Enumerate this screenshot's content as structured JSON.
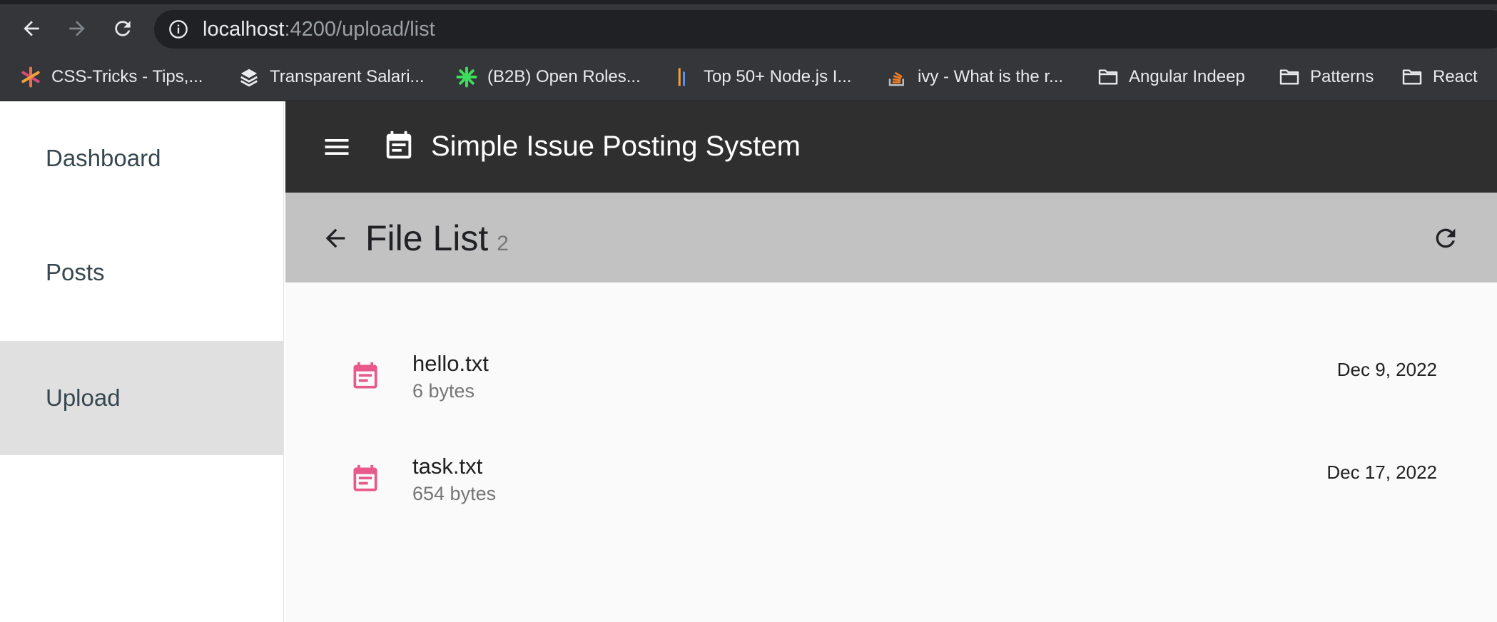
{
  "browser": {
    "url_host": "localhost",
    "url_path": ":4200/upload/list",
    "colors": {
      "chrome": "#35363a",
      "omnibox": "#202124",
      "text": "#e8eaed"
    }
  },
  "bookmarks": [
    {
      "label": "CSS-Tricks - Tips,...",
      "icon": "asterisk-icon"
    },
    {
      "label": "Transparent Salari...",
      "icon": "layers-icon"
    },
    {
      "label": "(B2B) Open Roles...",
      "icon": "asterisk-icon"
    },
    {
      "label": "Top 50+ Node.js I...",
      "icon": "bars-icon"
    },
    {
      "label": "ivy - What is the r...",
      "icon": "stack-icon"
    },
    {
      "label": "Angular Indeep",
      "icon": "folder-icon"
    },
    {
      "label": "Patterns",
      "icon": "folder-icon"
    },
    {
      "label": "React",
      "icon": "folder-icon"
    }
  ],
  "sidebar": {
    "items": [
      {
        "label": "Dashboard",
        "active": false
      },
      {
        "label": "Posts",
        "active": false
      },
      {
        "label": "Upload",
        "active": true
      }
    ]
  },
  "toolbar": {
    "title": "Simple Issue Posting System",
    "menu_icon": "menu-icon",
    "app_icon": "event-note-icon"
  },
  "page": {
    "title": "File List",
    "count": "2"
  },
  "files": [
    {
      "name": "hello.txt",
      "size": "6 bytes",
      "date": "Dec 9, 2022",
      "icon": "event-note-icon"
    },
    {
      "name": "task.txt",
      "size": "654 bytes",
      "date": "Dec 17, 2022",
      "icon": "event-note-icon"
    }
  ],
  "colors": {
    "toolbar_bg": "#2f2f2f",
    "subheader_bg": "#c2c2c2",
    "active_item_bg": "#e0e0e0",
    "file_icon": "#e8588a",
    "sidebar_text": "#36474f"
  }
}
